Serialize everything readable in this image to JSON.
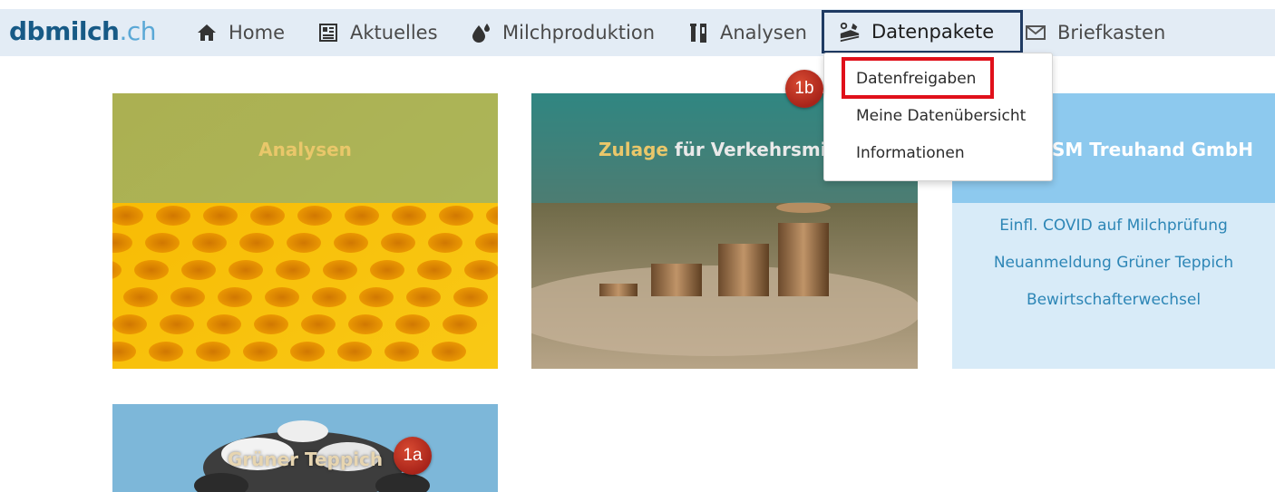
{
  "brand": {
    "part1": "dbmilch",
    "part2": ".ch"
  },
  "nav": {
    "items": [
      {
        "label": "Home"
      },
      {
        "label": "Aktuelles"
      },
      {
        "label": "Milchproduktion"
      },
      {
        "label": "Analysen"
      },
      {
        "label": "Datenpakete"
      },
      {
        "label": "Briefkasten"
      }
    ],
    "active": "Datenpakete"
  },
  "dropdown": {
    "items": [
      {
        "label": "Datenfreigaben"
      },
      {
        "label": "Meine Datenübersicht"
      },
      {
        "label": "Informationen"
      }
    ]
  },
  "tiles": {
    "analysen": {
      "title": "Analysen"
    },
    "zulage": {
      "title_part1": "Zulage",
      "title_part2": "für Verkehrsmi"
    },
    "treuhand": {
      "title": "SM Treuhand GmbH"
    },
    "gruener": {
      "title": "Grüner Teppich"
    }
  },
  "info_links": [
    "Einfl. COVID auf Milchprüfung",
    "Neuanmeldung Grüner Teppich",
    "Bewirtschafterwechsel"
  ],
  "annotations": {
    "a": "1a",
    "b": "1b"
  },
  "colors": {
    "nav_bg": "#e3ecf5",
    "active_border": "#1f3b63",
    "highlight_red": "#e0101a",
    "badge_red": "#b82a1d",
    "link_blue": "#2d86b6",
    "tile_title_gold": "#e9c76a"
  }
}
